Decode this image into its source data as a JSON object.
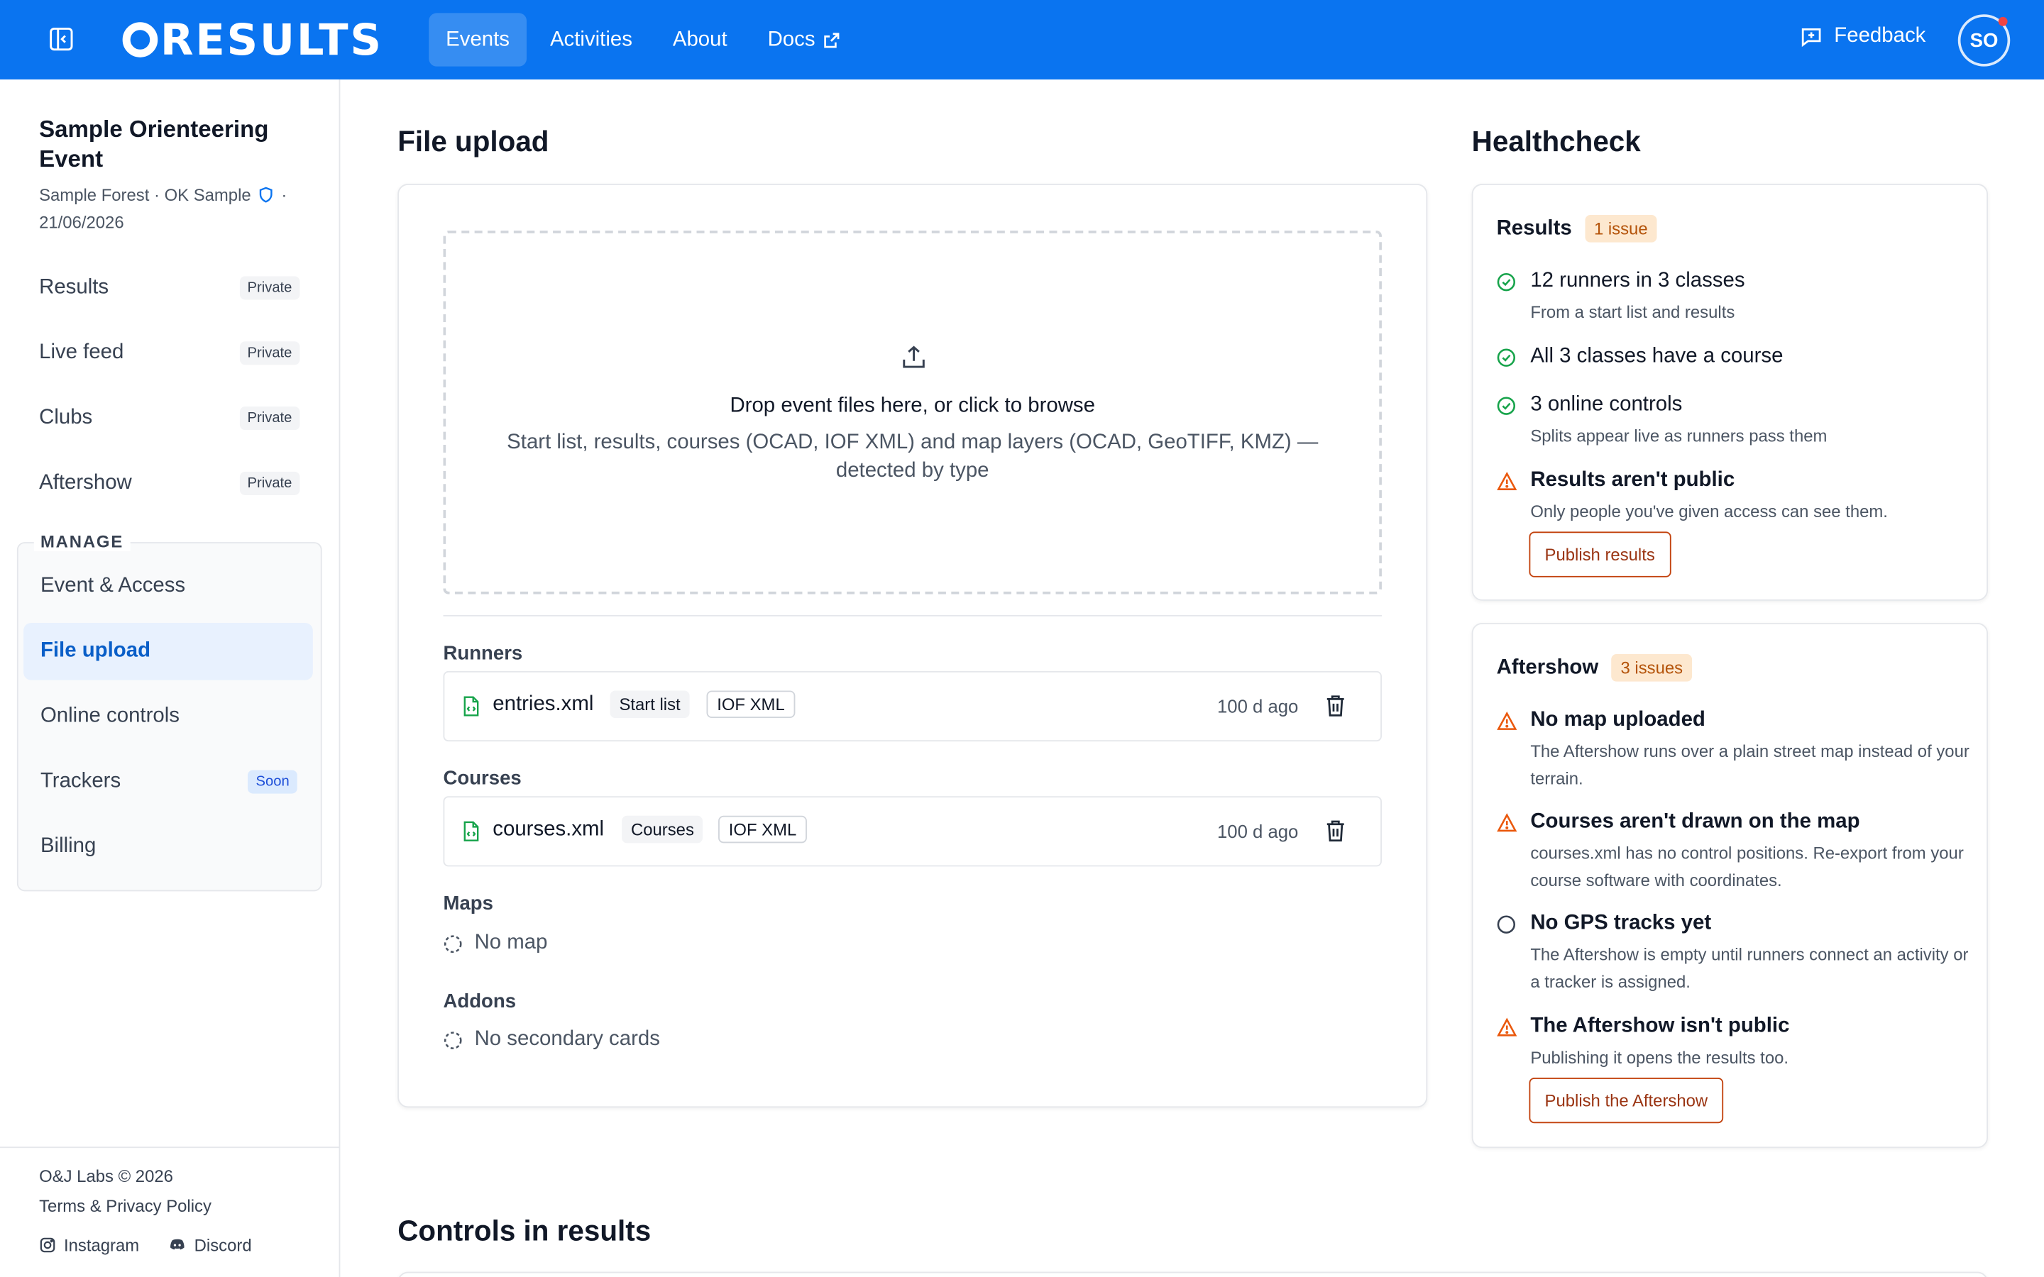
{
  "header": {
    "logo_text": "RESULTS",
    "nav": [
      {
        "label": "Events",
        "active": true
      },
      {
        "label": "Activities",
        "active": false
      },
      {
        "label": "About",
        "active": false
      },
      {
        "label": "Docs",
        "active": false,
        "external": true
      }
    ],
    "feedback_label": "Feedback",
    "avatar_initials": "SO",
    "brand_color": "#0a74f0"
  },
  "sidebar": {
    "event_title": "Sample Orienteering Event",
    "event_location": "Sample Forest · OK Sample",
    "event_date": "21/06/2026",
    "items": [
      {
        "label": "Results",
        "badge": "Private"
      },
      {
        "label": "Live feed",
        "badge": "Private"
      },
      {
        "label": "Clubs",
        "badge": "Private"
      },
      {
        "label": "Aftershow",
        "badge": "Private"
      }
    ],
    "manage_label": "MANAGE",
    "manage_items": [
      {
        "label": "Event & Access"
      },
      {
        "label": "File upload",
        "active": true
      },
      {
        "label": "Online controls"
      },
      {
        "label": "Trackers",
        "badge": "Soon"
      },
      {
        "label": "Billing"
      }
    ],
    "footer": {
      "copyright": "O&J Labs © 2026",
      "terms": "Terms & Privacy Policy",
      "instagram": "Instagram",
      "discord": "Discord"
    }
  },
  "main": {
    "file_upload_title": "File upload",
    "dropzone": {
      "title": "Drop event files here, or click to browse",
      "subtitle": "Start list, results, courses (OCAD, IOF XML) and map layers (OCAD, GeoTIFF, KMZ) — detected by type"
    },
    "runners_label": "Runners",
    "runners_file": {
      "name": "entries.xml",
      "kind": "Start list",
      "format": "IOF XML",
      "time": "100 d ago"
    },
    "courses_label": "Courses",
    "courses_file": {
      "name": "courses.xml",
      "kind": "Courses",
      "format": "IOF XML",
      "time": "100 d ago"
    },
    "maps_label": "Maps",
    "maps_empty": "No map",
    "addons_label": "Addons",
    "addons_empty": "No secondary cards",
    "controls_title": "Controls in results"
  },
  "healthcheck": {
    "title": "Healthcheck",
    "results": {
      "title": "Results",
      "badge": "1 issue",
      "items": [
        {
          "status": "ok",
          "main": "12 runners in 3 classes",
          "sub": "From a start list and results"
        },
        {
          "status": "ok",
          "main": "All 3 classes have a course",
          "sub": ""
        },
        {
          "status": "ok",
          "main": "3 online controls",
          "sub": "Splits appear live as runners pass them"
        },
        {
          "status": "warn",
          "main": "Results aren't public",
          "sub": "Only people you've given access can see them."
        }
      ],
      "button": "Publish results"
    },
    "aftershow": {
      "title": "Aftershow",
      "badge": "3 issues",
      "items": [
        {
          "status": "warn",
          "main": "No map uploaded",
          "sub": "The Aftershow runs over a plain street map instead of your terrain."
        },
        {
          "status": "warn",
          "main": "Courses aren't drawn on the map",
          "sub": "courses.xml has no control positions. Re-export from your course software with coordinates."
        },
        {
          "status": "pending",
          "main": "No GPS tracks yet",
          "sub": "The Aftershow is empty until runners connect an activity or a tracker is assigned."
        },
        {
          "status": "warn",
          "main": "The Aftershow isn't public",
          "sub": "Publishing it opens the results too."
        }
      ],
      "button": "Publish the Aftershow"
    },
    "colors": {
      "ok": "#16a34a",
      "warn": "#ea580c",
      "warn_badge_bg": "#fde8cf"
    }
  }
}
